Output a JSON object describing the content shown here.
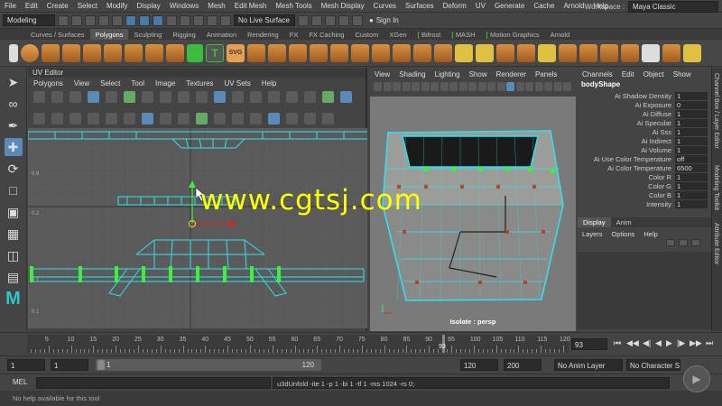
{
  "menubar": {
    "items": [
      "File",
      "Edit",
      "Create",
      "Select",
      "Modify",
      "Display",
      "Windows",
      "Mesh",
      "Edit Mesh",
      "Mesh Tools",
      "Mesh Display",
      "Curves",
      "Surfaces",
      "Deform",
      "UV",
      "Generate",
      "Cache",
      "Arnold",
      "Help"
    ],
    "workspace_label": "Workspace :",
    "workspace_value": "Maya Classic"
  },
  "statusline": {
    "mode": "Modeling",
    "live_surface": "No Live Surface",
    "sign_in": "Sign In"
  },
  "shelf": {
    "tabs": [
      "Curves / Surfaces",
      "Polygons",
      "Sculpting",
      "Rigging",
      "Animation",
      "Rendering",
      "FX",
      "FX Caching",
      "Custom",
      "XGen",
      "Bifrost",
      "MASH",
      "Motion Graphics",
      "Arnold"
    ],
    "active_tab": "Polygons",
    "svg_label": "SVG"
  },
  "uv_editor": {
    "title": "UV Editor",
    "menus": [
      "Polygons",
      "View",
      "Select",
      "Tool",
      "Image",
      "Textures",
      "UV Sets",
      "Help"
    ],
    "grid_labels": [
      "0.9",
      "0.2",
      "0.1",
      "0.1"
    ]
  },
  "viewport": {
    "menus": [
      "View",
      "Shading",
      "Lighting",
      "Show",
      "Renderer",
      "Panels"
    ],
    "caption": "Isolate : persp"
  },
  "channel_box": {
    "menus": [
      "Channels",
      "Edit",
      "Object",
      "Show"
    ],
    "shape": "bodyShape",
    "attributes": [
      {
        "name": "Ai Shadow Density",
        "value": "1"
      },
      {
        "name": "Ai Exposure",
        "value": "0"
      },
      {
        "name": "Ai Diffuse",
        "value": "1"
      },
      {
        "name": "Ai Specular",
        "value": "1"
      },
      {
        "name": "Ai Sss",
        "value": "1"
      },
      {
        "name": "Ai Indirect",
        "value": "1"
      },
      {
        "name": "Ai Volume",
        "value": "1"
      },
      {
        "name": "Ai Use Color Temperature",
        "value": "off"
      },
      {
        "name": "Ai Color Temperature",
        "value": "6500"
      },
      {
        "name": "Color R",
        "value": "1"
      },
      {
        "name": "Color G",
        "value": "1"
      },
      {
        "name": "Color B",
        "value": "1"
      },
      {
        "name": "Intensity",
        "value": "1"
      }
    ],
    "layer_tabs": [
      "Display",
      "Anim"
    ],
    "layer_menus": [
      "Layers",
      "Options",
      "Help"
    ],
    "side_tabs": [
      "Channel Box / Layer Editor",
      "Modeling Toolkit",
      "Attribute Editor"
    ]
  },
  "timeline": {
    "ticks": [
      "5",
      "10",
      "15",
      "20",
      "25",
      "30",
      "35",
      "40",
      "45",
      "50",
      "55",
      "60",
      "65",
      "70",
      "75",
      "80",
      "85",
      "90",
      "95",
      "100",
      "105",
      "110",
      "115",
      "120"
    ],
    "current_frame": "93",
    "current_frame_field": "93"
  },
  "range": {
    "start": "1",
    "playback_start": "1",
    "bar_start": "1",
    "bar_end": "120",
    "playback_end": "120",
    "end": "200",
    "anim_layer": "No Anim Layer",
    "character_set": "No Character Set"
  },
  "cmdline": {
    "lang": "MEL",
    "result": "u3dUnfold -ite 1 -p 1 -bi 1 -tf 1 -ms 1024 -rs 0;"
  },
  "helpline": "No help available for this tool",
  "watermark": "www.cgtsj.com"
}
